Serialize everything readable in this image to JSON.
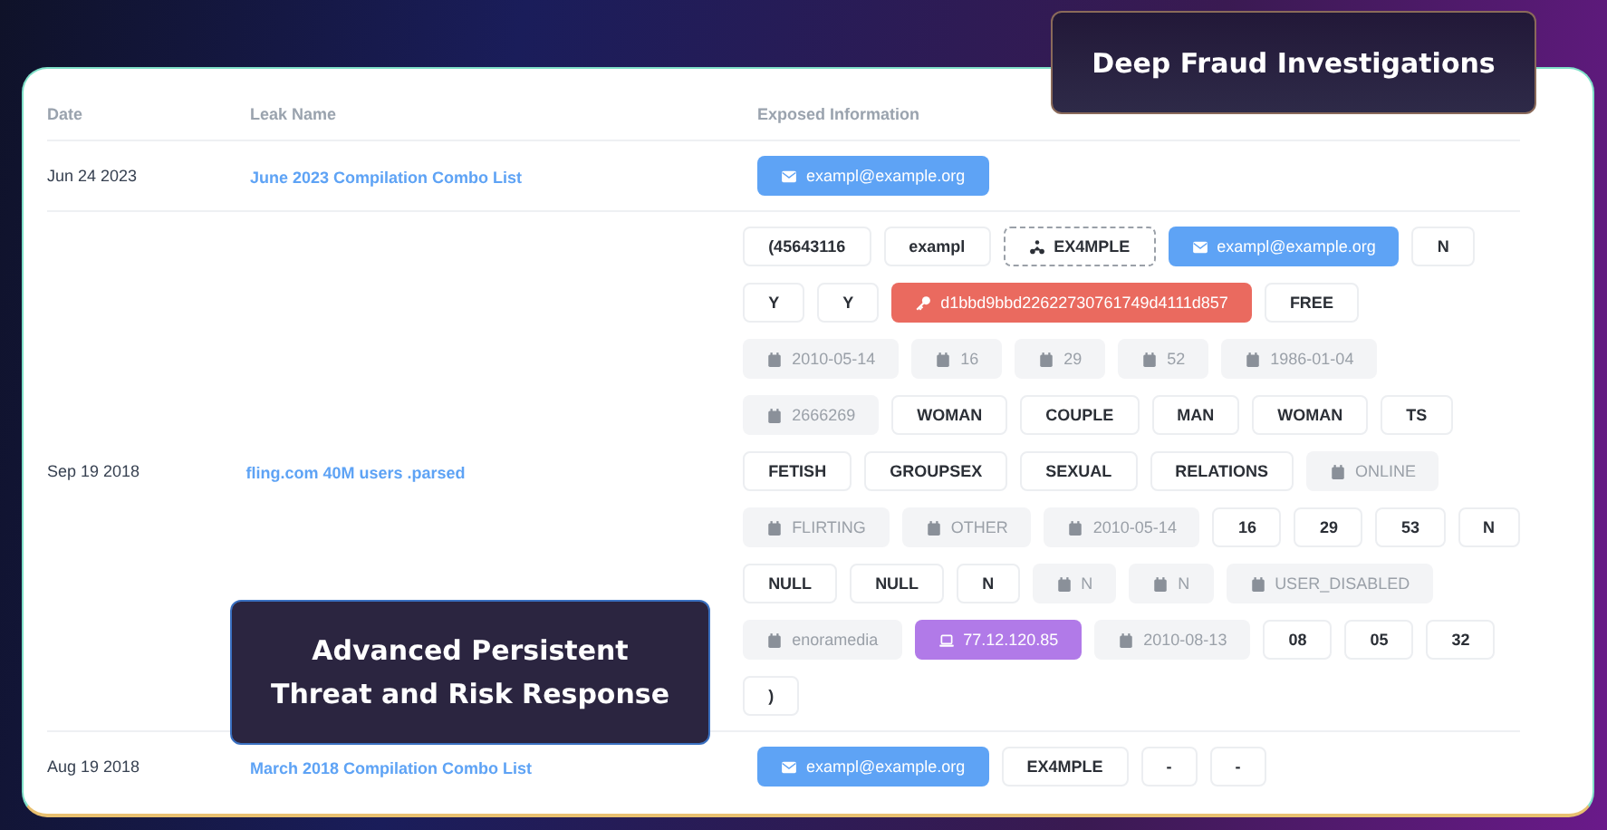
{
  "table": {
    "columns": [
      "Date",
      "Leak Name",
      "Exposed Information"
    ],
    "rows": [
      {
        "date": "Jun 24 2023",
        "leak_name": "June 2023 Compilation Combo List",
        "tag_lines": [
          [
            {
              "text": "exampl@example.org",
              "kind": "email"
            }
          ]
        ]
      },
      {
        "date": "Sep 19 2018",
        "leak_name": "fling.com 40M users .parsed",
        "tag_lines": [
          [
            {
              "text": "(45643116",
              "kind": "plain"
            },
            {
              "text": "exampl",
              "kind": "plain"
            },
            {
              "text": "EX4MPLE",
              "kind": "handle"
            },
            {
              "text": "exampl@example.org",
              "kind": "email"
            },
            {
              "text": "N",
              "kind": "plain"
            }
          ],
          [
            {
              "text": "Y",
              "kind": "plain"
            },
            {
              "text": "Y",
              "kind": "plain"
            },
            {
              "text": "d1bbd9bbd22622730761749d4111d857",
              "kind": "key"
            },
            {
              "text": "FREE",
              "kind": "plain"
            }
          ],
          [
            {
              "text": "2010-05-14",
              "kind": "dated"
            },
            {
              "text": "16",
              "kind": "dated"
            },
            {
              "text": "29",
              "kind": "dated"
            },
            {
              "text": "52",
              "kind": "dated"
            },
            {
              "text": "1986-01-04",
              "kind": "dated"
            }
          ],
          [
            {
              "text": "2666269",
              "kind": "dated"
            },
            {
              "text": "WOMAN",
              "kind": "plain"
            },
            {
              "text": "COUPLE",
              "kind": "plain"
            },
            {
              "text": "MAN",
              "kind": "plain"
            },
            {
              "text": "WOMAN",
              "kind": "plain"
            },
            {
              "text": "TS",
              "kind": "plain"
            }
          ],
          [
            {
              "text": "FETISH",
              "kind": "plain"
            },
            {
              "text": "GROUPSEX",
              "kind": "plain"
            },
            {
              "text": "SEXUAL",
              "kind": "plain"
            },
            {
              "text": "RELATIONS",
              "kind": "plain"
            },
            {
              "text": "ONLINE",
              "kind": "dated"
            }
          ],
          [
            {
              "text": "FLIRTING",
              "kind": "dated"
            },
            {
              "text": "OTHER",
              "kind": "dated"
            },
            {
              "text": "2010-05-14",
              "kind": "dated"
            },
            {
              "text": "16",
              "kind": "plain"
            },
            {
              "text": "29",
              "kind": "plain"
            },
            {
              "text": "53",
              "kind": "plain"
            },
            {
              "text": "N",
              "kind": "plain"
            }
          ],
          [
            {
              "text": "NULL",
              "kind": "plain"
            },
            {
              "text": "NULL",
              "kind": "plain"
            },
            {
              "text": "N",
              "kind": "plain"
            },
            {
              "text": "N",
              "kind": "dated"
            },
            {
              "text": "N",
              "kind": "dated"
            },
            {
              "text": "USER_DISABLED",
              "kind": "dated"
            }
          ],
          [
            {
              "text": "enoramedia",
              "kind": "dated"
            },
            {
              "text": "77.12.120.85",
              "kind": "ip"
            },
            {
              "text": "2010-08-13",
              "kind": "dated"
            },
            {
              "text": "08",
              "kind": "plain"
            },
            {
              "text": "05",
              "kind": "plain"
            },
            {
              "text": "32",
              "kind": "plain"
            }
          ],
          [
            {
              "text": ")",
              "kind": "plain"
            }
          ]
        ]
      },
      {
        "date": "Aug 19 2018",
        "leak_name": "March 2018 Compilation Combo List",
        "tag_lines": [
          [
            {
              "text": "exampl@example.org",
              "kind": "email"
            },
            {
              "text": "EX4MPLE",
              "kind": "plain"
            },
            {
              "text": "-",
              "kind": "plain"
            },
            {
              "text": "-",
              "kind": "plain"
            }
          ]
        ]
      }
    ]
  },
  "overlays": [
    {
      "text": "Deep Fraud Investigations",
      "kind": "top"
    },
    {
      "text": "Advanced Persistent Threat and Risk Response",
      "kind": "middle"
    }
  ]
}
